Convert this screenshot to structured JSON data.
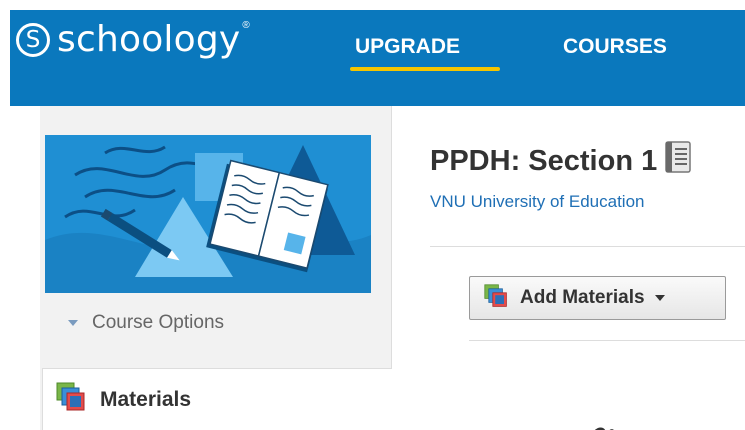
{
  "header": {
    "logo_text": "schoology",
    "logo_mark": "S",
    "logo_trademark": "®",
    "nav": [
      {
        "label": "UPGRADE",
        "active": true
      },
      {
        "label": "COURSES",
        "active": false
      }
    ],
    "colors": {
      "bar": "#0a78bd",
      "active_underline": "#f5c500"
    }
  },
  "sidebar": {
    "banner_image": "course-banner-illustration",
    "course_options_label": "Course Options",
    "items": [
      {
        "label": "Materials",
        "icon": "materials-icon",
        "active": true
      }
    ]
  },
  "main": {
    "course_title": "PPDH: Section 1",
    "title_icon": "course-notebook-icon",
    "school_name": "VNU University of Education",
    "add_materials_label": "Add Materials",
    "add_materials_icon": "materials-icon"
  },
  "colors": {
    "link": "#1f6fb5",
    "sidebar_bg": "#f2f2f2"
  }
}
